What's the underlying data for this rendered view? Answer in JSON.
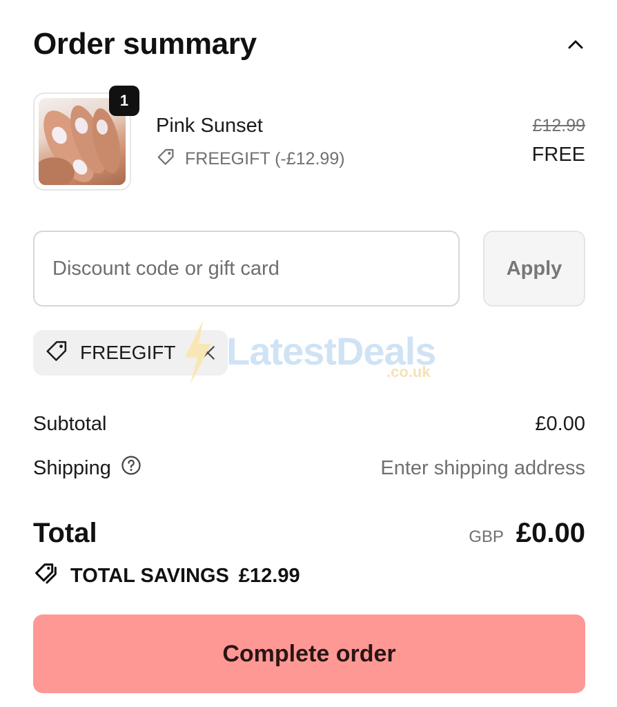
{
  "header": {
    "title": "Order summary",
    "toggle_icon": "chevron-up-icon"
  },
  "item": {
    "quantity": "1",
    "name": "Pink Sunset",
    "discount_code": "FREEGIFT (-£12.99)",
    "original_price": "£12.99",
    "price": "FREE"
  },
  "discount": {
    "placeholder": "Discount code or gift card",
    "value": "",
    "apply_label": "Apply"
  },
  "applied_code": {
    "label": "FREEGIFT"
  },
  "watermark": {
    "text": "LatestDeals",
    "sub": ".co.uk"
  },
  "summary": {
    "subtotal_label": "Subtotal",
    "subtotal_value": "£0.00",
    "shipping_label": "Shipping",
    "shipping_value": "Enter shipping address"
  },
  "total": {
    "label": "Total",
    "currency": "GBP",
    "value": "£0.00"
  },
  "savings": {
    "label": "TOTAL SAVINGS",
    "value": "£12.99"
  },
  "actions": {
    "complete_label": "Complete order"
  },
  "colors": {
    "primary_button": "#fe9895",
    "muted_text": "#707070",
    "chip_bg": "#f0f0f0"
  }
}
